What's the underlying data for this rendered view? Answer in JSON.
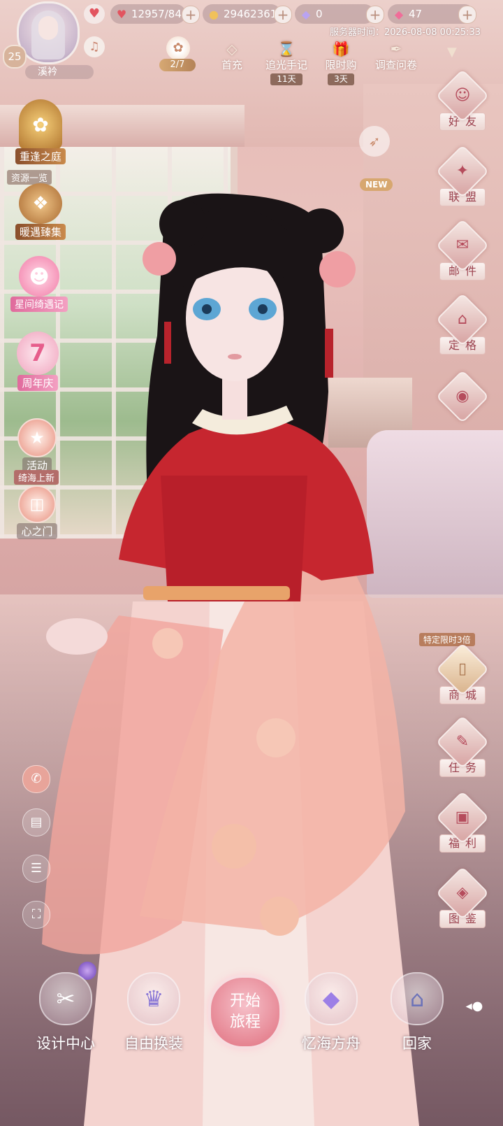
{
  "top_bar": {
    "stamina": "12957/84",
    "gold": "29462361",
    "diamonds": "0",
    "crystals": "47",
    "server_time": "服务器时间：2026-08-08 00:25:33"
  },
  "player": {
    "name": "溪衿",
    "level": "25"
  },
  "top_menu": {
    "progress": "2/7",
    "items": [
      {
        "label": "首充",
        "tag": ""
      },
      {
        "label": "追光手记",
        "tag": "11天"
      },
      {
        "label": "限时购",
        "tag": "3天"
      },
      {
        "label": "调查问卷",
        "tag": ""
      }
    ]
  },
  "left_menu": {
    "garden": "重逢之庭",
    "resources": "资源一览",
    "gather": "暖遇臻集",
    "stars": "星间绮遇记",
    "anniversary": "周年庆",
    "activity": "活动",
    "news": "绮海上新",
    "heart_gate": "心之门"
  },
  "right_menu": {
    "friends": "好友",
    "alliance": "联盟",
    "mail": "邮件",
    "pose": "定格",
    "shop_banner": "特定限时3倍",
    "shop": "商城",
    "tasks": "任务",
    "welfare": "福利",
    "gallery": "图鉴"
  },
  "new_badge": "NEW",
  "bottom_nav": {
    "design": "设计中心",
    "dressup": "自由换装",
    "start_line1": "开始",
    "start_line2": "旅程",
    "ark": "忆海方舟",
    "home": "回家"
  },
  "colors": {
    "accent": "#e0707f",
    "label_text": "#9a3f4c",
    "gold_tag": "#8d6a5c"
  }
}
